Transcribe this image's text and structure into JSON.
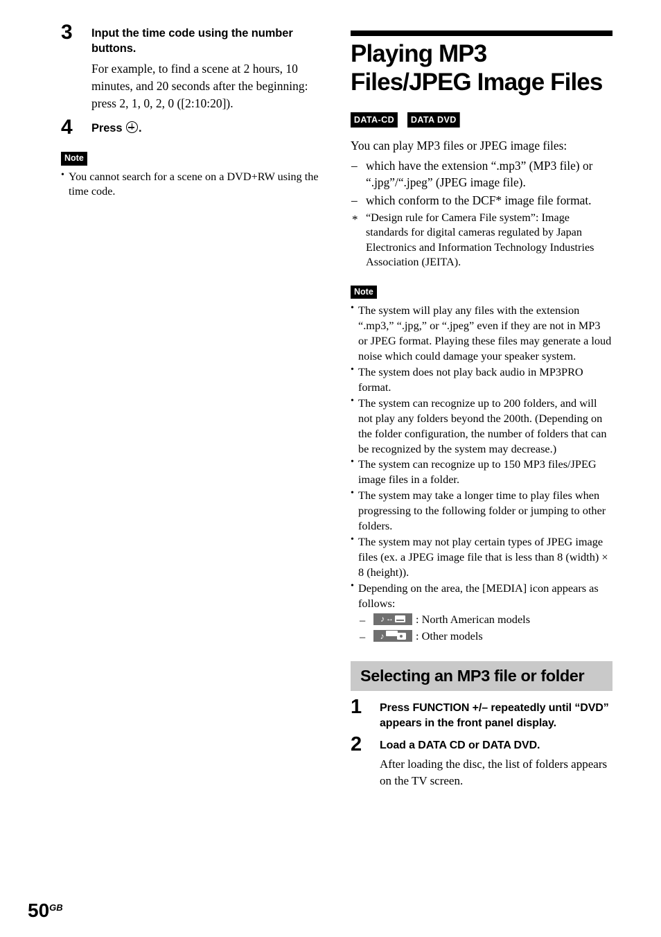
{
  "page": {
    "number": "50",
    "number_suffix": "GB"
  },
  "left_column": {
    "steps": [
      {
        "number": "3",
        "title": "Input the time code using the number buttons.",
        "body": "For example, to find a scene at 2 hours, 10 minutes, and 20 seconds after the beginning: press 2, 1, 0, 2, 0 ([2:10:20])."
      },
      {
        "number": "4",
        "title_before_glyph": "Press",
        "title_after_glyph": ".",
        "glyph_name": "enter-button-icon"
      }
    ],
    "note": {
      "badge": "Note",
      "items": [
        "You cannot search for a scene on a DVD+RW using the time code."
      ]
    }
  },
  "right_column": {
    "chapter_title": "Playing MP3 Files/JPEG Image Files",
    "disc_badges": [
      "DATA-CD",
      "DATA DVD"
    ],
    "intro": "You can play MP3 files or JPEG image files:",
    "dash_items": [
      "which have the extension “.mp3” (MP3 file) or “.jpg”/“.jpeg” (JPEG image file).",
      "which conform to the DCF* image file format."
    ],
    "footnote": "“Design rule for Camera File system”: Image standards for digital cameras regulated by Japan Electronics and Information Technology Industries Association (JEITA).",
    "note": {
      "badge": "Note",
      "items": [
        "The system will play any files with the extension “.mp3,” “.jpg,” or “.jpeg” even if they are not in MP3 or JPEG format. Playing these files may generate a loud noise which could damage your speaker system.",
        "The system does not play back audio in MP3PRO format.",
        "The system can recognize up to 200 folders, and will not play any folders beyond the 200th. (Depending on the folder configuration, the number of folders that can be recognized by the system may decrease.)",
        "The system can recognize up to 150 MP3 files/JPEG image files in a folder.",
        "The system may take a longer time to play files when progressing to the following folder or jumping to other folders.",
        "The system may not play certain types of JPEG image files (ex. a JPEG image file that is less than 8 (width) × 8 (height)).",
        "Depending on the area, the [MEDIA] icon appears as follows:"
      ],
      "media_variants": [
        {
          "icon": "media-music-display-icon",
          "label": ": North American models"
        },
        {
          "icon": "media-music-camera-icon",
          "label": ": Other models"
        }
      ]
    },
    "section": {
      "title": "Selecting an MP3 file or folder",
      "steps": [
        {
          "number": "1",
          "title": "Press FUNCTION +/– repeatedly until “DVD” appears in the front panel display.",
          "body": ""
        },
        {
          "number": "2",
          "title": "Load a DATA CD or DATA DVD.",
          "body": "After loading the disc, the list of folders appears on the TV screen."
        }
      ]
    }
  },
  "colors": {
    "section_bar": "#c9c9c9",
    "badge_bg": "#000000",
    "media_icon_bg": "#6f6f6f"
  }
}
